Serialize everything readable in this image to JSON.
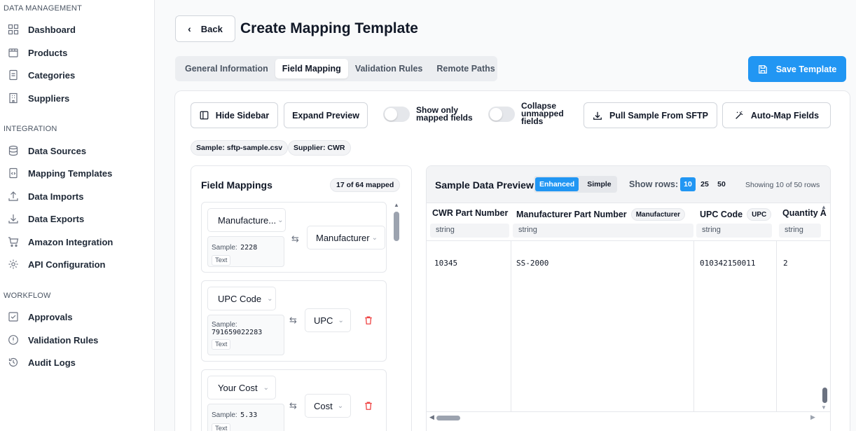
{
  "sidebar": {
    "sections": [
      {
        "title": "DATA MANAGEMENT",
        "items": [
          {
            "label": "Dashboard",
            "icon": "dashboard-icon"
          },
          {
            "label": "Products",
            "icon": "package-icon"
          },
          {
            "label": "Categories",
            "icon": "document-icon"
          },
          {
            "label": "Suppliers",
            "icon": "building-icon"
          }
        ]
      },
      {
        "title": "INTEGRATION",
        "items": [
          {
            "label": "Data Sources",
            "icon": "database-icon"
          },
          {
            "label": "Mapping Templates",
            "icon": "file-code-icon"
          },
          {
            "label": "Data Imports",
            "icon": "upload-icon"
          },
          {
            "label": "Data Exports",
            "icon": "download-icon"
          },
          {
            "label": "Amazon Integration",
            "icon": "cart-icon"
          },
          {
            "label": "API Configuration",
            "icon": "gear-icon"
          }
        ]
      },
      {
        "title": "WORKFLOW",
        "items": [
          {
            "label": "Approvals",
            "icon": "checkbox-icon"
          },
          {
            "label": "Validation Rules",
            "icon": "alert-circle-icon"
          },
          {
            "label": "Audit Logs",
            "icon": "history-icon"
          }
        ]
      }
    ]
  },
  "header": {
    "back_label": "Back",
    "title": "Create Mapping Template",
    "tabs": [
      {
        "label": "General Information",
        "active": false
      },
      {
        "label": "Field Mapping",
        "active": true
      },
      {
        "label": "Validation Rules",
        "active": false
      },
      {
        "label": "Remote Paths",
        "active": false
      }
    ],
    "save_label": "Save Template"
  },
  "toolbar": {
    "hide_sidebar": "Hide Sidebar",
    "expand_preview": "Expand Preview",
    "show_only_mapped_1": "Show only",
    "show_only_mapped_2": "mapped fields",
    "collapse_1": "Collapse",
    "collapse_2": "unmapped",
    "collapse_3": "fields",
    "pull_sample": "Pull Sample From SFTP",
    "auto_map": "Auto-Map Fields"
  },
  "chips": {
    "sample": "Sample: sftp-sample.csv",
    "supplier": "Supplier: CWR"
  },
  "field_mappings": {
    "title": "Field Mappings",
    "count": "17 of 64 mapped",
    "items": [
      {
        "source": "Manufacture...",
        "sample_label": "Sample:",
        "sample_value": "2228",
        "type": "Text",
        "target": "Manufacturer"
      },
      {
        "source": "UPC Code",
        "sample_label": "Sample:",
        "sample_value": "791659022283",
        "type": "Text",
        "target": "UPC"
      },
      {
        "source": "Your Cost",
        "sample_label": "Sample:",
        "sample_value": "5.33",
        "type": "Text",
        "target": "Cost"
      }
    ]
  },
  "preview": {
    "title": "Sample Data Preview",
    "modes": [
      {
        "label": "Enhanced",
        "active": true
      },
      {
        "label": "Simple",
        "active": false
      }
    ],
    "rows_label": "Show rows:",
    "rows_options": [
      {
        "label": "10",
        "active": true
      },
      {
        "label": "25",
        "active": false
      },
      {
        "label": "50",
        "active": false
      }
    ],
    "showing": "Showing 10 of 50 rows",
    "columns": [
      {
        "name": "CWR Part Number",
        "badge": "",
        "type": "string",
        "value": "10345"
      },
      {
        "name": "Manufacturer Part Number",
        "badge": "Manufacturer",
        "type": "string",
        "value": "SS-2000"
      },
      {
        "name": "UPC Code",
        "badge": "UPC",
        "type": "string",
        "value": "010342150011"
      },
      {
        "name": "Quantity A",
        "badge": "",
        "type": "string",
        "value": "2"
      }
    ]
  },
  "colors": {
    "accent": "#2196f3",
    "danger": "#ef4444"
  }
}
